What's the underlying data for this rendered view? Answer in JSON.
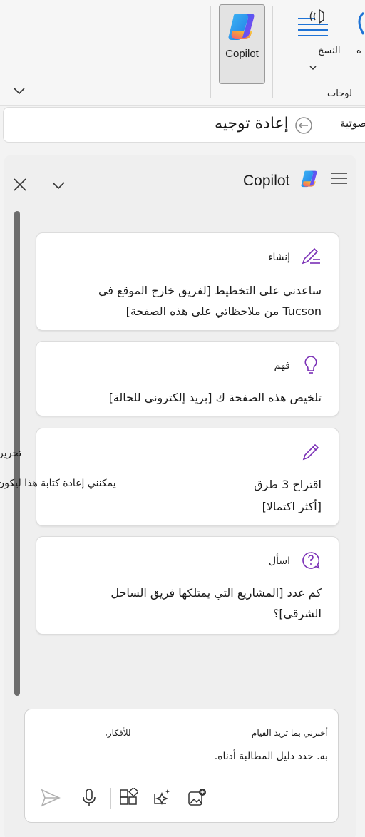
{
  "ribbon": {
    "copilot_label": "Copilot",
    "transcribe_label": "النسخ",
    "group_label": "لوحات",
    "cut_label": "ه"
  },
  "strip": {
    "title": "إعادة توجيه",
    "cut_text": "صوتية"
  },
  "pane": {
    "title": "Copilot",
    "cards": [
      {
        "category": "إنشاء",
        "lines": [
          "ساعدني على التخطيط [لفريق خارج الموقع في",
          "Tucson من ملاحظاتي على هذه الصفحة]"
        ]
      },
      {
        "category": "فهم",
        "lines": [
          "تلخيص هذه الصفحة ك [بريد إلكتروني للحالة]"
        ]
      },
      {
        "category": "",
        "lines": [
          "اقتراح 3 طرق",
          "[أكثر اكتمالا]"
        ]
      },
      {
        "category": "اسأل",
        "lines": [
          "كم عدد [المشاريع التي يمتلكها فريق الساحل",
          "الشرقي]؟"
        ]
      }
    ],
    "side_text": {
      "edit": "تحرير",
      "rewrite": "يمكنني إعادة كتابة هذا ليكون"
    }
  },
  "composer": {
    "line1_right": "أخبرني بما تريد القيام",
    "line1_left": "للأفكار،",
    "line2": "به. حدد دليل المطالبة أدناه."
  },
  "colors": {
    "accent": "#0f6cbd",
    "card_icon": "#7a2fb6",
    "background": "#f3f3f3"
  },
  "icons": [
    "chevron-down-icon",
    "copilot-logo-icon",
    "transcribe-icon",
    "back-arrow-icon",
    "close-icon",
    "hamburger-menu-icon",
    "compose-icon",
    "lightbulb-icon",
    "pencil-icon",
    "question-icon",
    "send-icon",
    "microphone-icon",
    "plugins-icon",
    "sparkle-icon",
    "add-image-icon"
  ]
}
